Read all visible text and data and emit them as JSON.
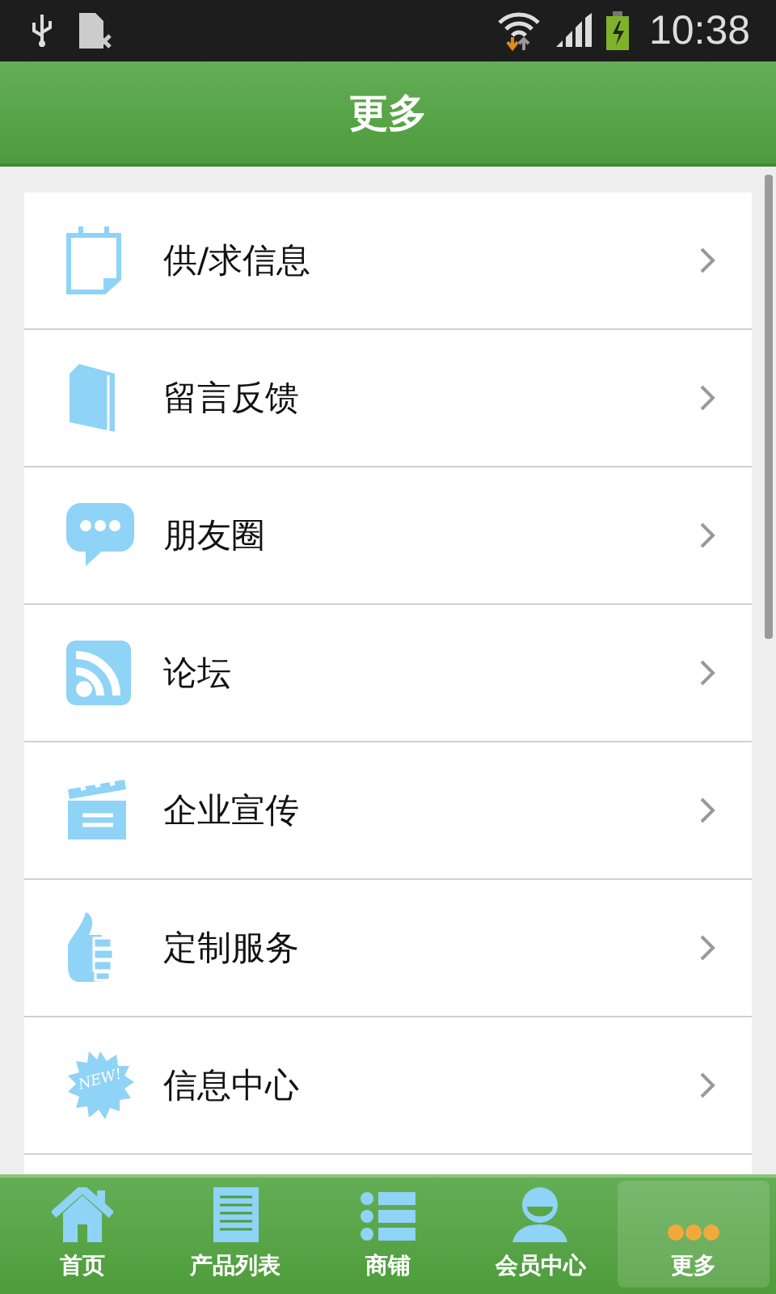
{
  "status_bar": {
    "time": "10:38"
  },
  "header": {
    "title": "更多"
  },
  "menu_items": [
    {
      "label": "供/求信息",
      "kind": "calendar"
    },
    {
      "label": "留言反馈",
      "kind": "book"
    },
    {
      "label": "朋友圈",
      "kind": "chat"
    },
    {
      "label": "论坛",
      "kind": "rss"
    },
    {
      "label": "企业宣传",
      "kind": "clapper"
    },
    {
      "label": "定制服务",
      "kind": "thumb"
    },
    {
      "label": "信息中心",
      "kind": "new",
      "icon_text": "NEW!"
    }
  ],
  "tab_bar": [
    {
      "label": "首页",
      "kind": "home",
      "selected": false
    },
    {
      "label": "产品列表",
      "kind": "list",
      "selected": false
    },
    {
      "label": "商铺",
      "kind": "bullets",
      "selected": false
    },
    {
      "label": "会员中心",
      "kind": "member",
      "selected": false
    },
    {
      "label": "更多",
      "kind": "more",
      "selected": true
    }
  ]
}
